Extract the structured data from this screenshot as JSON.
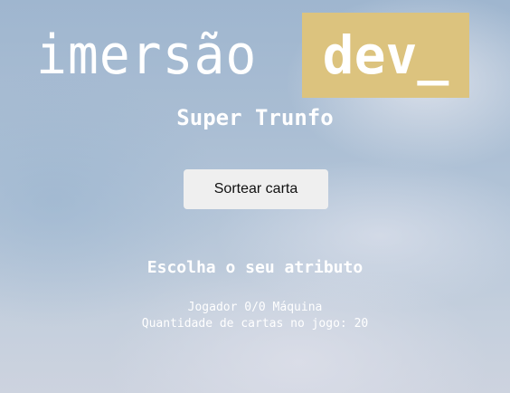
{
  "logo": {
    "text": "imersão",
    "badge": "dev_",
    "badge_color": "#dcc37e"
  },
  "title": "Super Trunfo",
  "draw_button": {
    "label": "Sortear carta"
  },
  "attribute_heading": "Escolha o seu atributo",
  "scoreboard": "Jogador 0/0 Máquina",
  "cards_remaining": "Quantidade de cartas no jogo: 20"
}
